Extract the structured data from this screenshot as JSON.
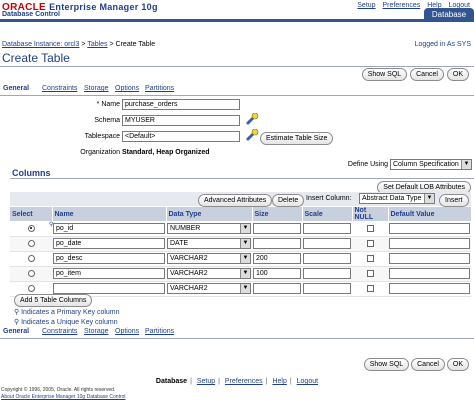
{
  "header": {
    "logo": "ORACLE",
    "product": "Enterprise Manager 10g",
    "subtitle": "Database Control",
    "links": [
      "Setup",
      "Preferences",
      "Help",
      "Logout"
    ],
    "tab": "Database"
  },
  "breadcrumb": {
    "items": [
      "Database Instance: orcl3",
      "Tables"
    ],
    "current": "Create Table",
    "sep": ">"
  },
  "logged_in": "Logged in As SYS",
  "page_title": "Create Table",
  "actions": {
    "show_sql": "Show SQL",
    "cancel": "Cancel",
    "ok": "OK"
  },
  "subtabs": [
    "General",
    "Constraints",
    "Storage",
    "Options",
    "Partitions"
  ],
  "form": {
    "name_label": "* Name",
    "name_value": "purchase_orders",
    "schema_label": "Schema",
    "schema_value": "MYUSER",
    "tablespace_label": "Tablespace",
    "tablespace_value": "<Default>",
    "estimate_button": "Estimate Table Size",
    "organization_label": "Organization",
    "organization_value": "Standard, Heap Organized",
    "define_using_label": "Define Using",
    "define_using_value": "Column Specification"
  },
  "columns_section": {
    "title": "Columns",
    "set_default_lob": "Set Default LOB Attributes",
    "advanced_attributes": "Advanced Attributes",
    "delete": "Delete",
    "insert_column_label": "Insert Column:",
    "insert_type": "Abstract Data Type",
    "insert_button": "Insert",
    "headers": [
      "Select",
      "Name",
      "Data Type",
      "Size",
      "Scale",
      "Not NULL",
      "Default Value"
    ],
    "rows": [
      {
        "name": "po_id",
        "type": "NUMBER",
        "size": "",
        "scale": "",
        "selected": true,
        "pk_icon": true,
        "uk_icon": false
      },
      {
        "name": "po_date",
        "type": "DATE",
        "size": "",
        "scale": "",
        "selected": false,
        "pk_icon": false,
        "uk_icon": false
      },
      {
        "name": "po_desc",
        "type": "VARCHAR2",
        "size": "200",
        "scale": "",
        "selected": false,
        "pk_icon": false,
        "uk_icon": false
      },
      {
        "name": "po_item",
        "type": "VARCHAR2",
        "size": "100",
        "scale": "",
        "selected": false,
        "pk_icon": false,
        "uk_icon": false
      },
      {
        "name": "",
        "type": "VARCHAR2",
        "size": "",
        "scale": "",
        "selected": false,
        "pk_icon": false,
        "uk_icon": false
      }
    ],
    "add_columns": "Add 5 Table Columns",
    "legend_pk": "Indicates a Primary Key column",
    "legend_uk": "Indicates a Unique Key column"
  },
  "footer": {
    "links": [
      "Database",
      "Setup",
      "Preferences",
      "Help",
      "Logout"
    ],
    "copyright": "Copyright © 1996, 2005, Oracle. All rights reserved.",
    "about": "About Oracle Enterprise Manager 10g Database Control"
  },
  "colors": {
    "brand_red": "#cc0000",
    "link_blue": "#1f3f8c",
    "tab_blue": "#33558f"
  }
}
